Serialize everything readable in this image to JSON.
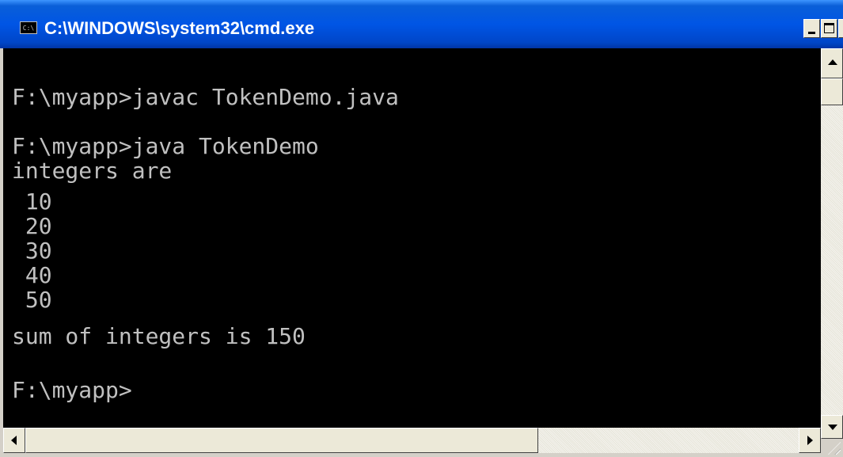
{
  "window": {
    "title": "C:\\WINDOWS\\system32\\cmd.exe",
    "icon_label": "C:\\",
    "icon": "console-window-icon"
  },
  "console": {
    "lines": [
      "F:\\myapp>javac TokenDemo.java",
      "",
      "F:\\myapp>java TokenDemo",
      "integers are",
      " 10",
      " 20",
      " 30",
      " 40",
      " 50",
      "sum of integers is 150",
      "",
      "F:\\myapp>"
    ],
    "text_color": "#c0c0c0",
    "background_color": "#000000"
  },
  "titlebar_buttons": {
    "minimize_icon": "minimize-icon",
    "maximize_icon": "maximize-icon",
    "close_icon": "close-icon"
  },
  "scrollbars": {
    "up_icon": "arrow-up-icon",
    "down_icon": "arrow-down-icon",
    "left_icon": "arrow-left-icon",
    "right_icon": "arrow-right-icon"
  }
}
